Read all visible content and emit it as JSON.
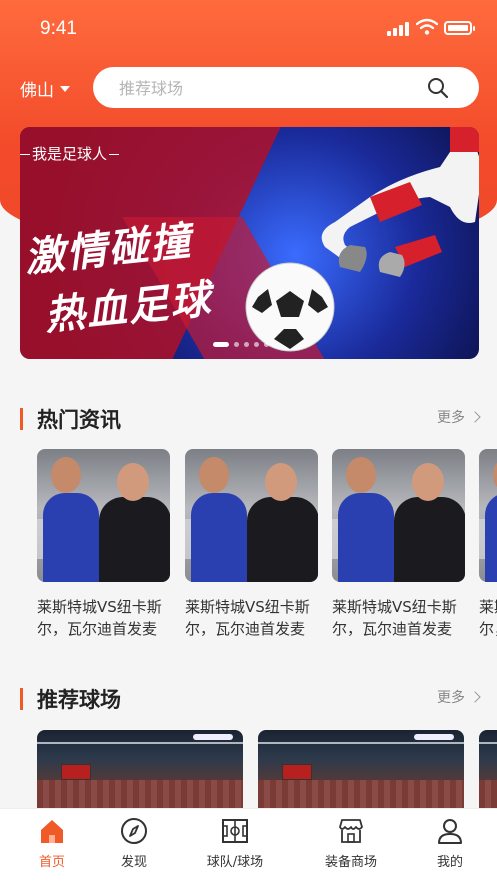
{
  "status": {
    "time": "9:41"
  },
  "header": {
    "city": "佛山",
    "search_placeholder": "推荐球场"
  },
  "banner": {
    "tagline": "我是足球人",
    "headline_line1": "激情碰撞",
    "headline_line2": "热血足球",
    "slides": 5,
    "active_slide": 1
  },
  "hot_news": {
    "title": "热门资讯",
    "more": "更多",
    "items": [
      {
        "title": "莱斯特城VS纽卡斯尔，瓦尔迪首发麦"
      },
      {
        "title": "莱斯特城VS纽卡斯尔，瓦尔迪首发麦"
      },
      {
        "title": "莱斯特城VS纽卡斯尔，瓦尔迪首发麦"
      },
      {
        "title": "莱斯特城VS纽卡斯尔，瓦尔迪首发麦"
      }
    ]
  },
  "recommended_fields": {
    "title": "推荐球场",
    "more": "更多"
  },
  "tabbar": {
    "items": [
      {
        "label": "首页",
        "icon": "home-icon",
        "active": true
      },
      {
        "label": "发现",
        "icon": "compass-icon",
        "active": false
      },
      {
        "label": "球队/球场",
        "icon": "pitch-icon",
        "active": false
      },
      {
        "label": "装备商场",
        "icon": "store-icon",
        "active": false
      },
      {
        "label": "我的",
        "icon": "user-icon",
        "active": false
      }
    ]
  },
  "colors": {
    "accent": "#f05a28",
    "header_gradient_top": "#ff6b3d",
    "header_gradient_bottom": "#f0492a"
  }
}
